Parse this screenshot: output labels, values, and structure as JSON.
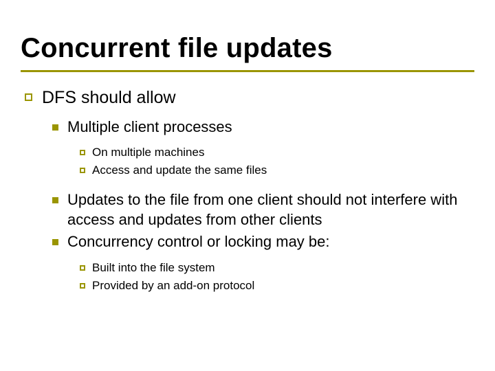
{
  "title": "Concurrent file updates",
  "l1_0": "DFS should allow",
  "l2_0": "Multiple client processes",
  "l3_0": "On multiple machines",
  "l3_1": "Access and update the same files",
  "l2_1": "Updates to the file from one client should not interfere with access and updates from other clients",
  "l2_2": "Concurrency control or locking may be:",
  "l3_2": "Built into the file system",
  "l3_3": "Provided by an add-on protocol"
}
